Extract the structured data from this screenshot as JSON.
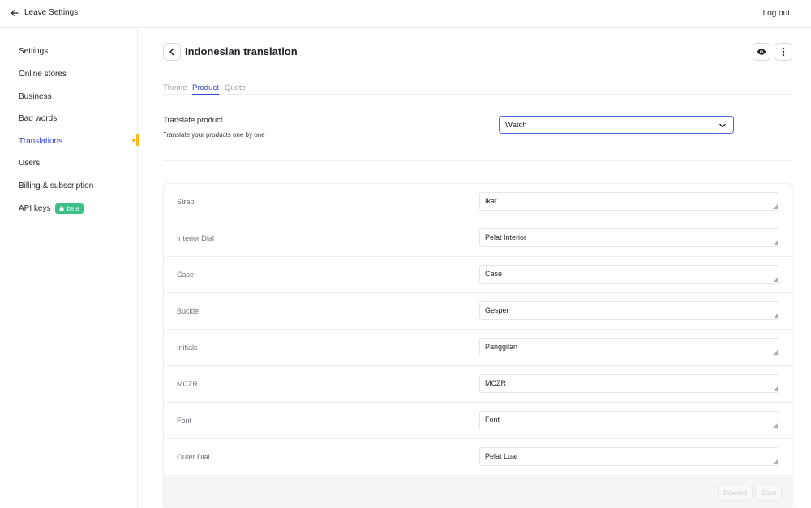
{
  "topbar": {
    "back_label": "Leave Settings",
    "logout_label": "Log out"
  },
  "sidebar": {
    "items": [
      {
        "label": "Settings"
      },
      {
        "label": "Online stores"
      },
      {
        "label": "Business"
      },
      {
        "label": "Bad words"
      },
      {
        "label": "Translations",
        "active": true
      },
      {
        "label": "Users"
      },
      {
        "label": "Billing & subscription"
      },
      {
        "label": "API keys",
        "badge": "beta"
      }
    ]
  },
  "page": {
    "title": "Indonesian translation"
  },
  "tabs": [
    {
      "label": "Theme"
    },
    {
      "label": "Product",
      "active": true
    },
    {
      "label": "Quote"
    }
  ],
  "translate_product": {
    "label": "Translate product",
    "description": "Translate your products one by one",
    "selected": "Watch"
  },
  "rows": [
    {
      "label": "Strap",
      "value": "Ikat"
    },
    {
      "label": "Interior Dial",
      "value": "Pelat Interior"
    },
    {
      "label": "Case",
      "value": "Case"
    },
    {
      "label": "Buckle",
      "value": "Gesper"
    },
    {
      "label": "Initials",
      "value": "Panggilan"
    },
    {
      "label": "MCZR",
      "value": "MCZR"
    },
    {
      "label": "Font",
      "value": "Font"
    },
    {
      "label": "Outer Dial",
      "value": "Pelat Luar"
    }
  ],
  "footer": {
    "discard_label": "Discard",
    "save_label": "Save"
  },
  "colors": {
    "accent": "#3346d3",
    "active_marker": "#f6b81a",
    "beta_badge": "#3ebf8a"
  }
}
